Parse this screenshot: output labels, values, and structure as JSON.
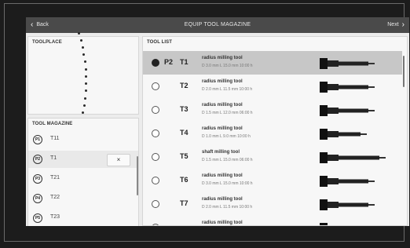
{
  "topbar": {
    "back_label": "Back",
    "title": "EQUIP TOOL MAGAZINE",
    "next_label": "Next"
  },
  "toolplace": {
    "header": "TOOLPLACE"
  },
  "magazine": {
    "header": "TOOL MAGAZINE",
    "remove_label": "×",
    "items": [
      {
        "place": "P1",
        "tool": "T11"
      },
      {
        "place": "P2",
        "tool": "T1"
      },
      {
        "place": "P3",
        "tool": "T21"
      },
      {
        "place": "P4",
        "tool": "T22"
      },
      {
        "place": "P5",
        "tool": "T23"
      },
      {
        "place": "",
        "tool": ""
      }
    ]
  },
  "tool_list": {
    "header": "TOOL LIST",
    "rows": [
      {
        "place": "P2",
        "tool": "T1",
        "name": "radius milling tool",
        "spec": "D 3.0 mm L 15.0 mm 10:00 h",
        "selected": true
      },
      {
        "place": "",
        "tool": "T2",
        "name": "radius milling tool",
        "spec": "D 2.0 mm L 11.5 mm 10:00 h"
      },
      {
        "place": "",
        "tool": "T3",
        "name": "radius milling tool",
        "spec": "D 1.5 mm L 12.0 mm 06:00 h"
      },
      {
        "place": "",
        "tool": "T4",
        "name": "radius milling tool",
        "spec": "D 1.0 mm L 9.0 mm 10:00 h"
      },
      {
        "place": "",
        "tool": "T5",
        "name": "shaft milling tool",
        "spec": "D 1.5 mm L 15.0 mm 06:00 h"
      },
      {
        "place": "",
        "tool": "T6",
        "name": "radius milling tool",
        "spec": "D 3.0 mm L 15.0 mm 10:00 h"
      },
      {
        "place": "",
        "tool": "T7",
        "name": "radius milling tool",
        "spec": "D 2.0 mm L 11.5 mm 10:00 h"
      },
      {
        "place": "",
        "tool": "",
        "name": "radius milling tool",
        "spec": ""
      }
    ]
  }
}
